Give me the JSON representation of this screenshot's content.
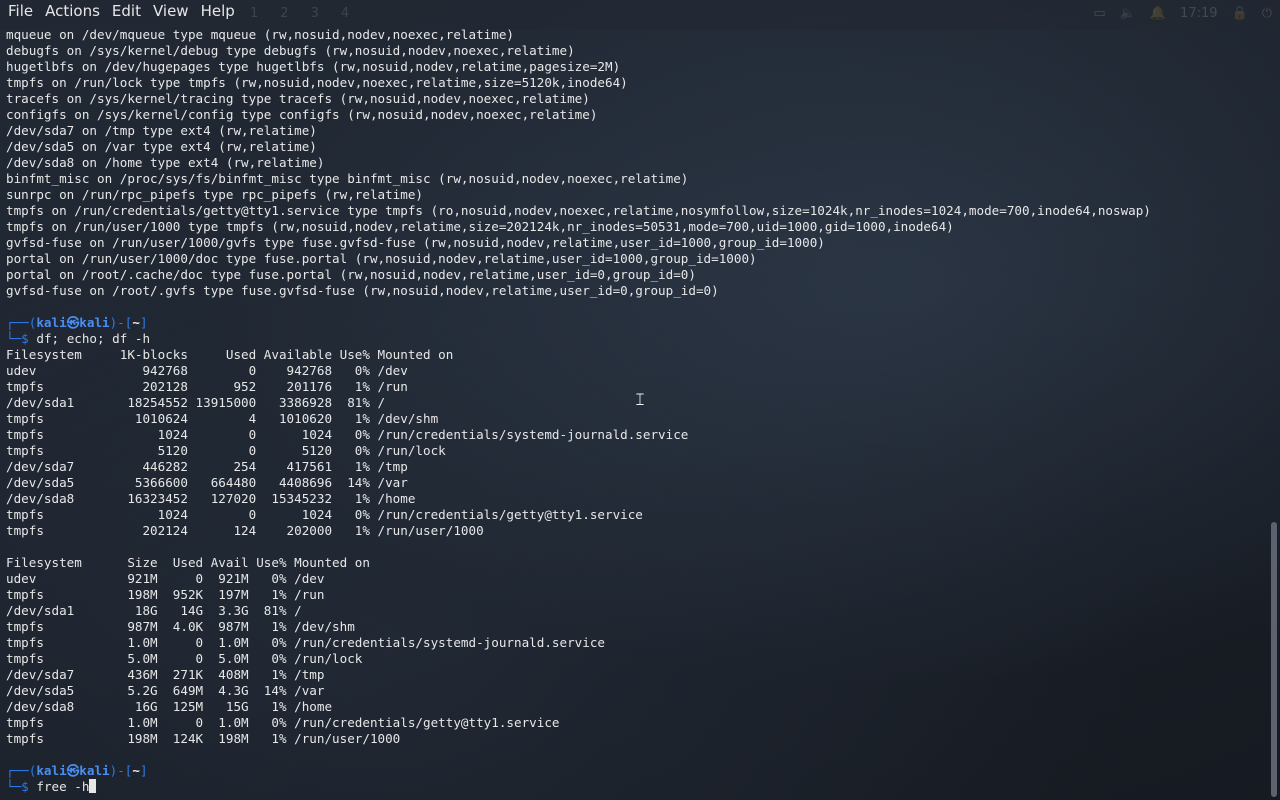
{
  "menubar": {
    "items": [
      "File",
      "Actions",
      "Edit",
      "View",
      "Help"
    ]
  },
  "background": {
    "workspaces": [
      "1",
      "2",
      "3",
      "4"
    ],
    "clock": "17:19"
  },
  "terminal": {
    "mount_lines": [
      "mqueue on /dev/mqueue type mqueue (rw,nosuid,nodev,noexec,relatime)",
      "debugfs on /sys/kernel/debug type debugfs (rw,nosuid,nodev,noexec,relatime)",
      "hugetlbfs on /dev/hugepages type hugetlbfs (rw,nosuid,nodev,relatime,pagesize=2M)",
      "tmpfs on /run/lock type tmpfs (rw,nosuid,nodev,noexec,relatime,size=5120k,inode64)",
      "tracefs on /sys/kernel/tracing type tracefs (rw,nosuid,nodev,noexec,relatime)",
      "configfs on /sys/kernel/config type configfs (rw,nosuid,nodev,noexec,relatime)",
      "/dev/sda7 on /tmp type ext4 (rw,relatime)",
      "/dev/sda5 on /var type ext4 (rw,relatime)",
      "/dev/sda8 on /home type ext4 (rw,relatime)",
      "binfmt_misc on /proc/sys/fs/binfmt_misc type binfmt_misc (rw,nosuid,nodev,noexec,relatime)",
      "sunrpc on /run/rpc_pipefs type rpc_pipefs (rw,relatime)",
      "tmpfs on /run/credentials/getty@tty1.service type tmpfs (ro,nosuid,nodev,noexec,relatime,nosymfollow,size=1024k,nr_inodes=1024,mode=700,inode64,noswap)",
      "tmpfs on /run/user/1000 type tmpfs (rw,nosuid,nodev,relatime,size=202124k,nr_inodes=50531,mode=700,uid=1000,gid=1000,inode64)",
      "gvfsd-fuse on /run/user/1000/gvfs type fuse.gvfsd-fuse (rw,nosuid,nodev,relatime,user_id=1000,group_id=1000)",
      "portal on /run/user/1000/doc type fuse.portal (rw,nosuid,nodev,relatime,user_id=1000,group_id=1000)",
      "portal on /root/.cache/doc type fuse.portal (rw,nosuid,nodev,relatime,user_id=0,group_id=0)",
      "gvfsd-fuse on /root/.gvfs type fuse.gvfsd-fuse (rw,nosuid,nodev,relatime,user_id=0,group_id=0)"
    ],
    "prompt": {
      "top_prefix": "┌──(",
      "user": "kali",
      "at": "㉿",
      "host": "kali",
      "mid": ")-[",
      "path": "~",
      "end": "]",
      "bottom_prefix": "└─",
      "dollar": "$"
    },
    "command1": "df; echo; df -h",
    "df_lines": [
      "Filesystem     1K-blocks     Used Available Use% Mounted on",
      "udev              942768        0    942768   0% /dev",
      "tmpfs             202128      952    201176   1% /run",
      "/dev/sda1       18254552 13915000   3386928  81% /",
      "tmpfs            1010624        4   1010620   1% /dev/shm",
      "tmpfs               1024        0      1024   0% /run/credentials/systemd-journald.service",
      "tmpfs               5120        0      5120   0% /run/lock",
      "/dev/sda7         446282      254    417561   1% /tmp",
      "/dev/sda5        5366600   664480   4408696  14% /var",
      "/dev/sda8       16323452   127020  15345232   1% /home",
      "tmpfs               1024        0      1024   0% /run/credentials/getty@tty1.service",
      "tmpfs             202124      124    202000   1% /run/user/1000"
    ],
    "dfh_lines": [
      "Filesystem      Size  Used Avail Use% Mounted on",
      "udev            921M     0  921M   0% /dev",
      "tmpfs           198M  952K  197M   1% /run",
      "/dev/sda1        18G   14G  3.3G  81% /",
      "tmpfs           987M  4.0K  987M   1% /dev/shm",
      "tmpfs           1.0M     0  1.0M   0% /run/credentials/systemd-journald.service",
      "tmpfs           5.0M     0  5.0M   0% /run/lock",
      "/dev/sda7       436M  271K  408M   1% /tmp",
      "/dev/sda5       5.2G  649M  4.3G  14% /var",
      "/dev/sda8        16G  125M   15G   1% /home",
      "tmpfs           1.0M     0  1.0M   0% /run/credentials/getty@tty1.service",
      "tmpfs           198M  124K  198M   1% /run/user/1000"
    ],
    "command2": "free -h"
  }
}
